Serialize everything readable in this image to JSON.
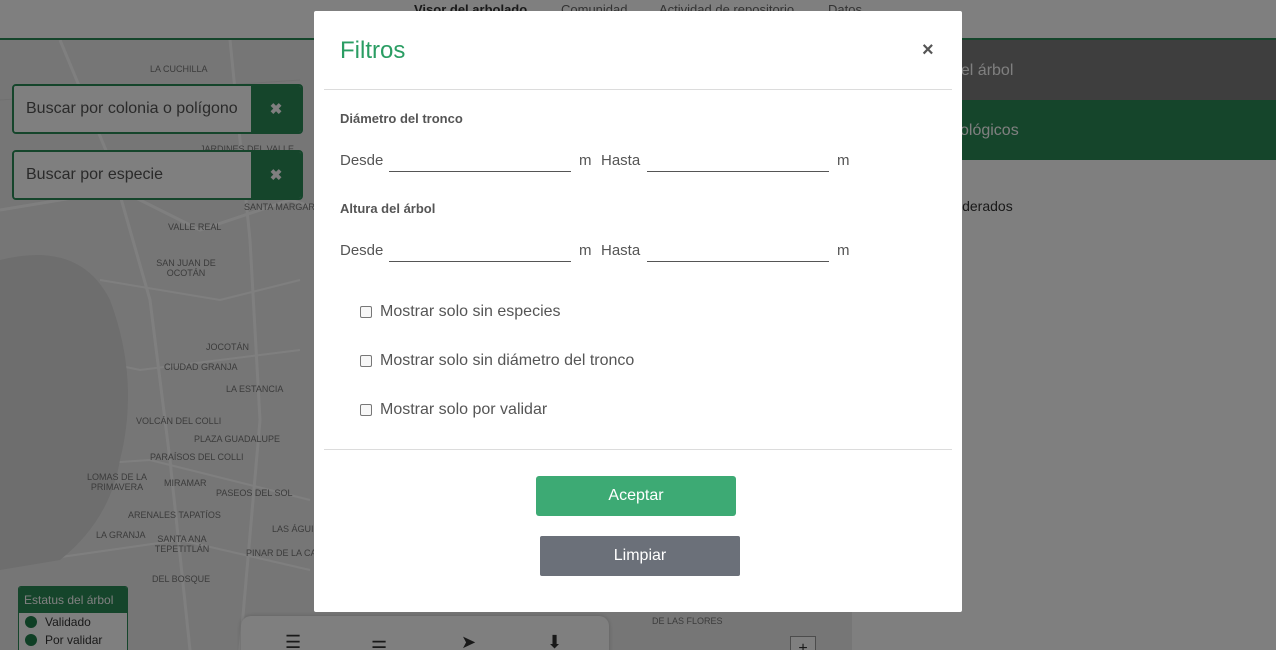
{
  "topnav": {
    "tabs": [
      "Visor del arbolado",
      "Comunidad",
      "Actividad de repositorio",
      "Datos"
    ]
  },
  "map": {
    "search_colonia_placeholder": "Buscar por colonia o polígono",
    "search_especie_placeholder": "Buscar por especie",
    "clear_icon": "✖",
    "labels": {
      "la_cuchilla": "LA CUCHILLA",
      "jardines_del_valle": "JARDINES DEL VALLE",
      "santa_margarita": "SANTA MARGARITA",
      "valle_real": "VALLE REAL",
      "san_juan_de_ocotan": "SAN JUAN DE OCOTÁN",
      "jocotan": "JOCOTÁN",
      "ciudad_granja": "CIUDAD GRANJA",
      "la_estancia": "LA ESTANCIA",
      "volcan_del_colli": "VOLCÁN DEL COLLI",
      "plaza_guadalupe": "PLAZA GUADALUPE",
      "paraisos_del_colli": "PARAÍSOS DEL COLLI",
      "lomas_de_la_primavera": "LOMAS DE LA PRIMAVERA",
      "miramar": "MIRAMAR",
      "paseos_del_sol": "PASEOS DEL SOL",
      "arenales_tapatios": "ARENALES TAPATÍOS",
      "la_granja": "LA GRANJA",
      "santa_ana_tepetitlan": "SANTA ANA TEPETITLÁN",
      "las_aguilas": "LAS ÁGUILAS",
      "pinar_de_la_calma": "PINAR DE LA CALMA",
      "del_bosque": "DEL BOSQUE",
      "de_las_flores": "DE LAS FLORES"
    },
    "legend": {
      "title": "Estatus del árbol",
      "items": [
        "Validado",
        "Por validar"
      ],
      "color": "#1e7f4b"
    },
    "toolbar_icons": [
      "menu-icon",
      "sliders-icon",
      "navigation-arrow-icon",
      "download-icon"
    ],
    "zoom_in": "+"
  },
  "sidepanel": {
    "row1": "del árbol",
    "row2": "cológicos",
    "row3": "siderados"
  },
  "modal": {
    "title": "Filtros",
    "close": "×",
    "trunk_section": "Diámetro del tronco",
    "height_section": "Altura del árbol",
    "from_label": "Desde",
    "to_label": "Hasta",
    "unit": "m",
    "trunk_from_value": "",
    "trunk_to_value": "",
    "height_from_value": "",
    "height_to_value": "",
    "checkboxes": [
      {
        "label": "Mostrar solo sin especies",
        "checked": false
      },
      {
        "label": "Mostrar solo sin diámetro del tronco",
        "checked": false
      },
      {
        "label": "Mostrar solo por validar",
        "checked": false
      }
    ],
    "accept_label": "Aceptar",
    "clear_label": "Limpiar"
  },
  "colors": {
    "brand_green": "#2a8a57",
    "title_green": "#2a9d63",
    "accept_button": "#3daa74",
    "clear_button": "#6b7079"
  }
}
